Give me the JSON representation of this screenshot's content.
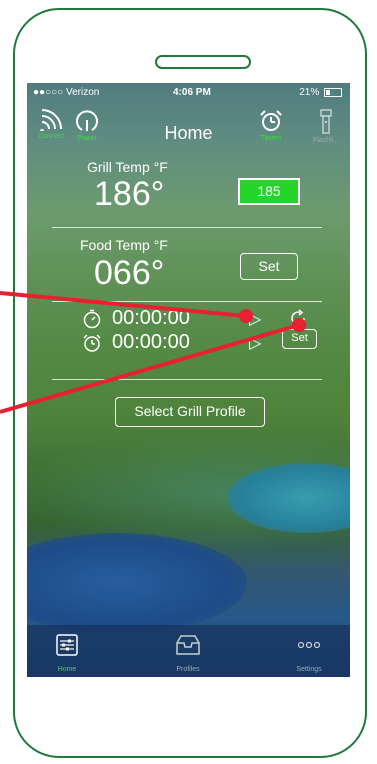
{
  "status_bar": {
    "carrier": "●●○○○ Verizon",
    "time": "4:06 PM",
    "battery": "21%"
  },
  "nav": {
    "title": "Home",
    "connect_label": "Connect",
    "power_label": "Power",
    "timers_label": "Timers",
    "flashlight_label": "Flashli..."
  },
  "grill": {
    "label": "Grill Temp °F",
    "value": "186°",
    "setpoint": "185"
  },
  "food": {
    "label": "Food Temp °F",
    "value": "066°",
    "set_label": "Set"
  },
  "timers": [
    {
      "value": "00:00:00"
    },
    {
      "value": "00:00:00",
      "set_label": "Set"
    }
  ],
  "profile_button": "Select Grill Profile",
  "tabs": [
    {
      "label": "Home",
      "active": true
    },
    {
      "label": "Profiles",
      "active": false
    },
    {
      "label": "Settings",
      "active": false
    }
  ],
  "colors": {
    "frame": "#1f7a3a",
    "accent_green": "#27d42a",
    "pointer_red": "#e8202f",
    "tab_active": "#3fdc3f"
  }
}
